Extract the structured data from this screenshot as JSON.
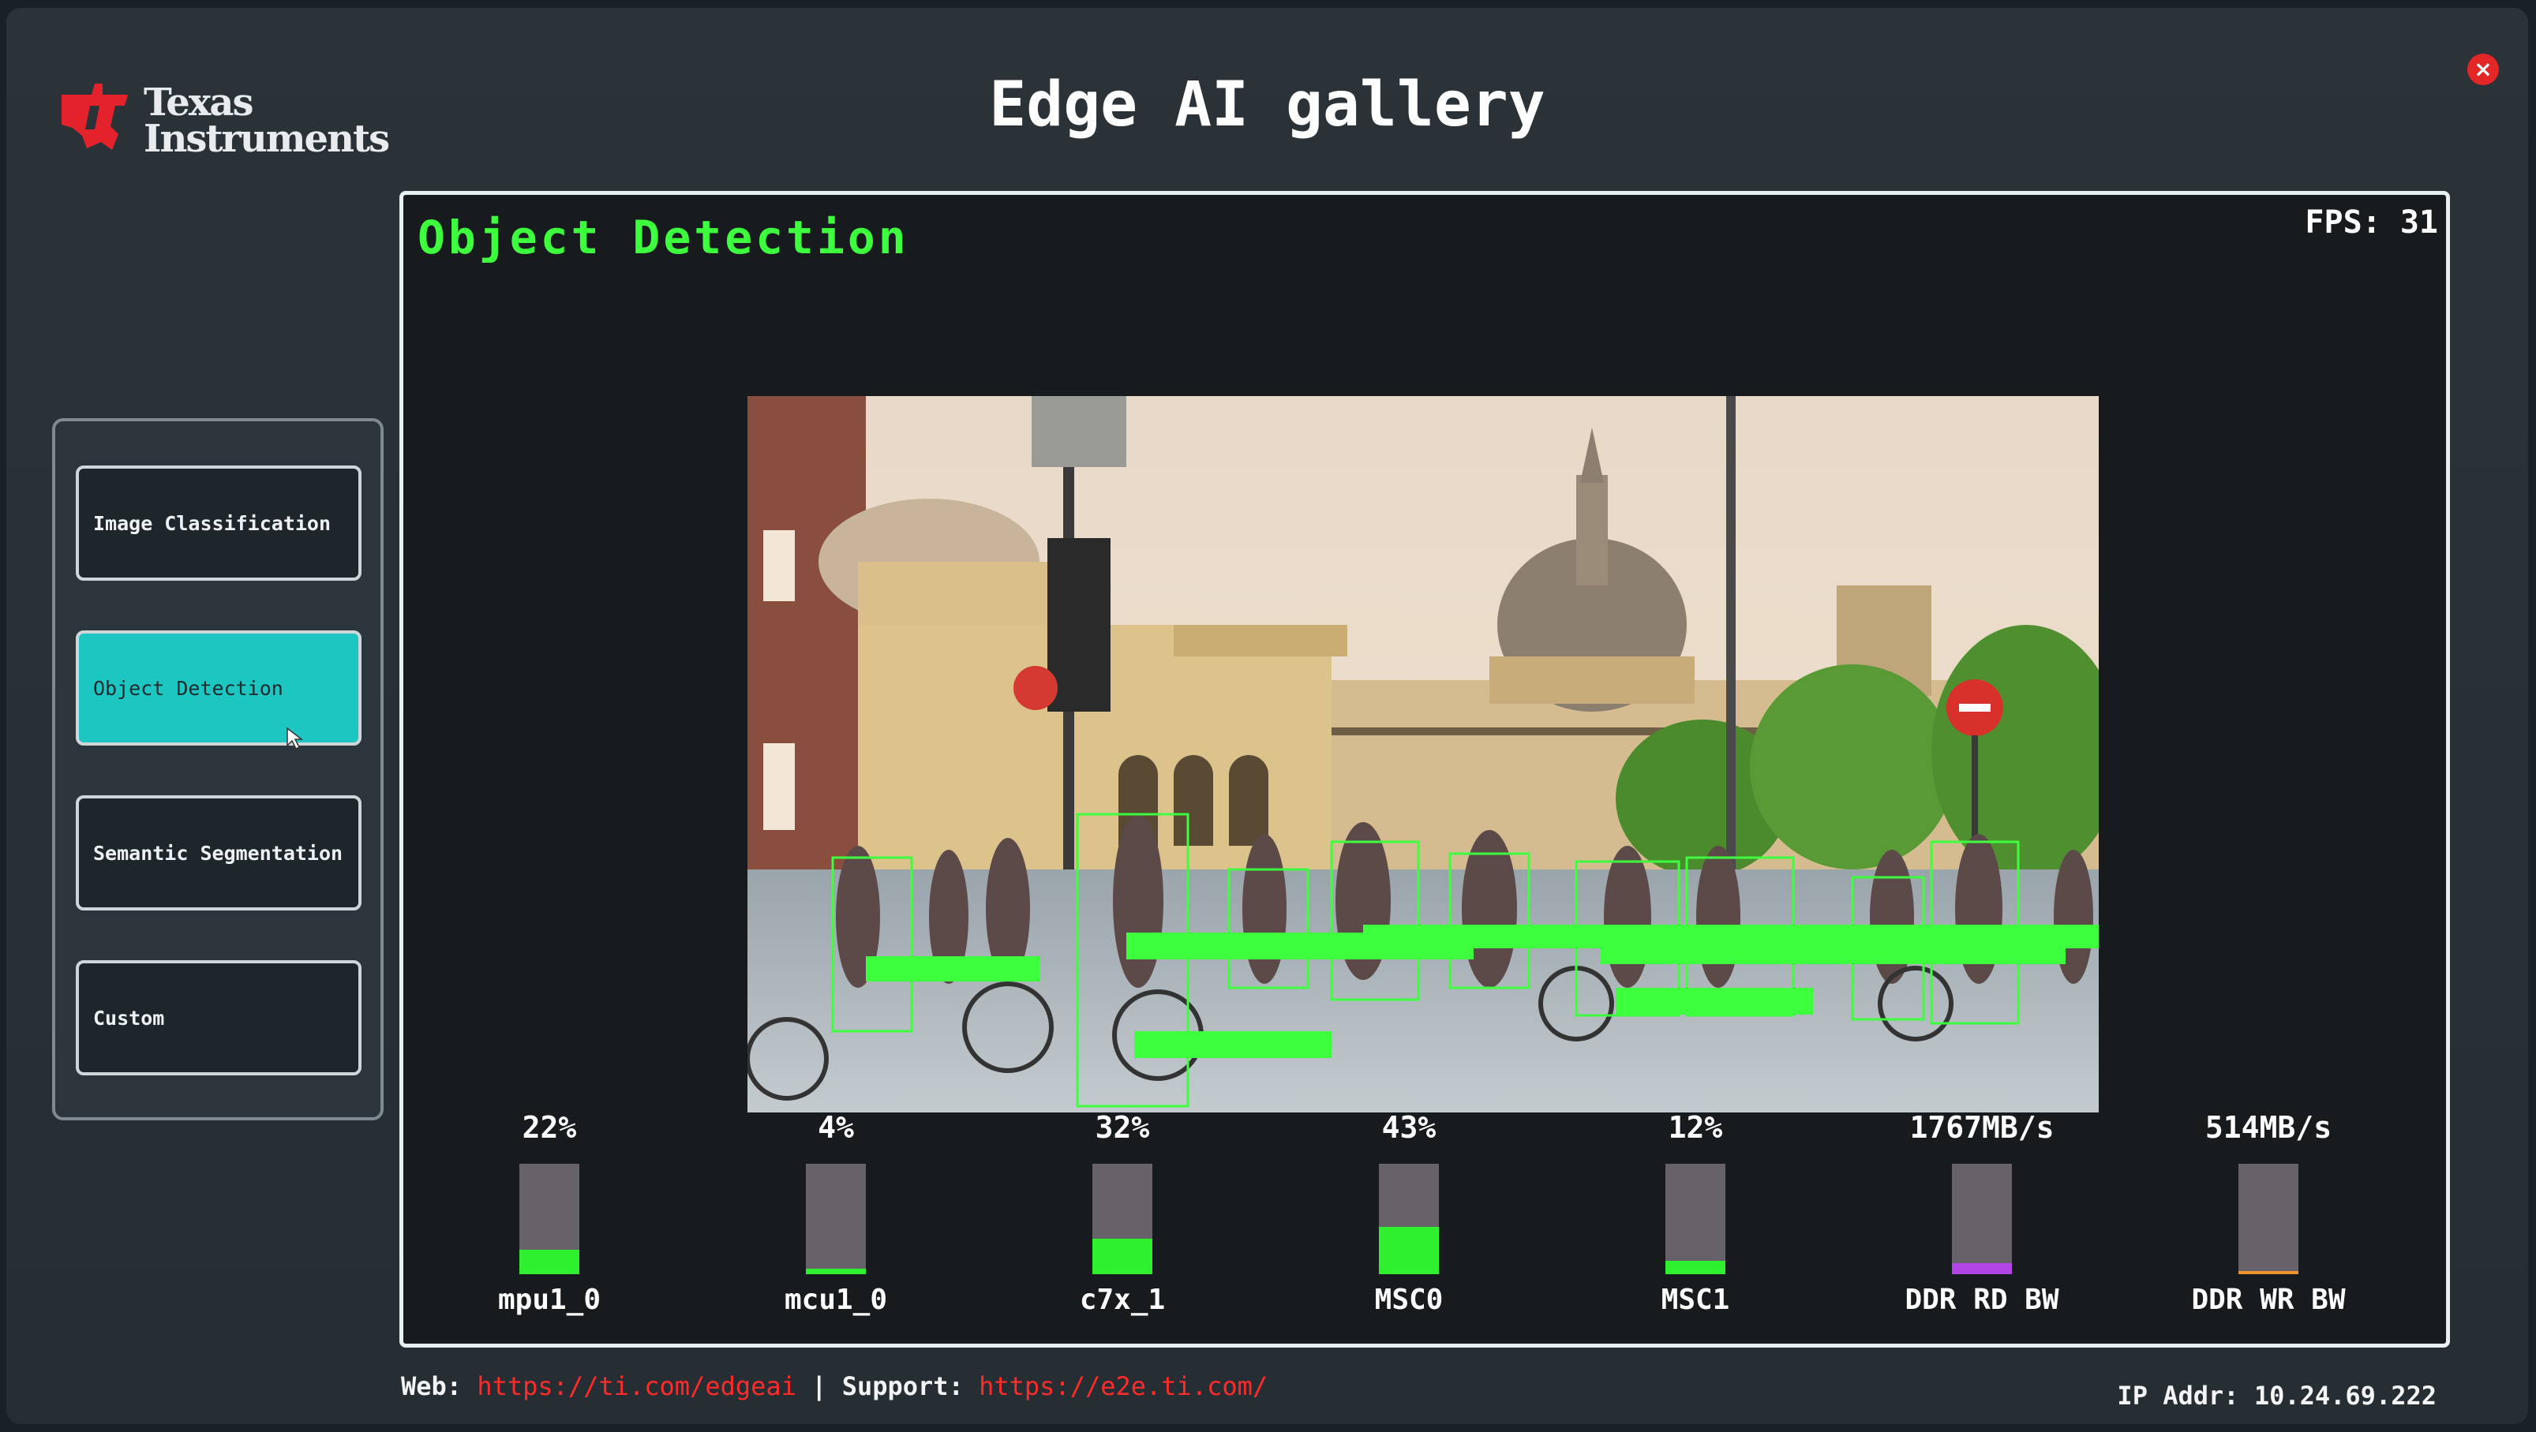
{
  "header": {
    "logo_line1": "Texas",
    "logo_line2": "Instruments",
    "title": "Edge AI gallery",
    "close_glyph": "×"
  },
  "sidebar": {
    "items": [
      {
        "label": "Image Classification",
        "active": false
      },
      {
        "label": "Object Detection",
        "active": true
      },
      {
        "label": "Semantic Segmentation",
        "active": false
      },
      {
        "label": "Custom",
        "active": false
      }
    ]
  },
  "main": {
    "demo_title": "Object Detection",
    "fps_label": "FPS:",
    "fps_value": "31"
  },
  "stats": [
    {
      "value": "22%",
      "label": "mpu1_0",
      "fill_fraction": 0.22,
      "color": "#2ef02e"
    },
    {
      "value": "4%",
      "label": "mcu1_0",
      "fill_fraction": 0.05,
      "color": "#2ef02e"
    },
    {
      "value": "32%",
      "label": "c7x_1",
      "fill_fraction": 0.32,
      "color": "#2ef02e"
    },
    {
      "value": "43%",
      "label": "MSC0",
      "fill_fraction": 0.43,
      "color": "#2ef02e"
    },
    {
      "value": "12%",
      "label": "MSC1",
      "fill_fraction": 0.12,
      "color": "#2ef02e"
    },
    {
      "value": "1767MB/s",
      "label": "DDR RD BW",
      "fill_fraction": 0.1,
      "color": "#b145e8"
    },
    {
      "value": "514MB/s",
      "label": "DDR WR BW",
      "fill_fraction": 0.03,
      "color": "#f0942c"
    }
  ],
  "footer": {
    "web_label": "Web:",
    "web_url": "https://ti.com/edgeai",
    "separator": "|",
    "support_label": "Support:",
    "support_url": "https://e2e.ti.com/",
    "ip_label": "IP Addr:",
    "ip_value": "10.24.69.222"
  },
  "colors": {
    "accent_active": "#1ec6c2",
    "detection_green": "#3dff3d",
    "close_red": "#e32626",
    "link_red": "#ff2a2a"
  },
  "icons": {
    "logo": "ti-logo-icon",
    "close": "close-icon"
  }
}
